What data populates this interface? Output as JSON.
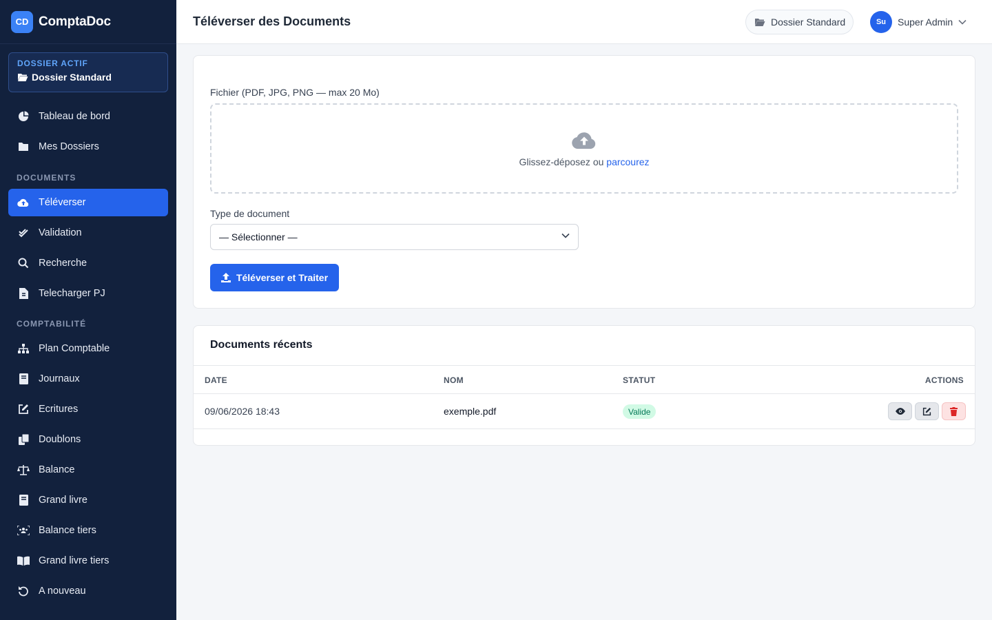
{
  "brand": {
    "badge": "CD",
    "name": "ComptaDoc"
  },
  "active_folder": {
    "label": "DOSSIER ACTIF",
    "value": "Dossier Standard"
  },
  "sidebar": {
    "items_top": [
      {
        "label": "Tableau de bord",
        "icon": "pie-chart-icon"
      },
      {
        "label": "Mes Dossiers",
        "icon": "folder-icon"
      }
    ],
    "section_documents": "DOCUMENTS",
    "items_documents": [
      {
        "label": "Téléverser",
        "icon": "cloud-upload-icon",
        "active": true
      },
      {
        "label": "Validation",
        "icon": "double-check-icon"
      },
      {
        "label": "Recherche",
        "icon": "search-icon"
      },
      {
        "label": "Telecharger PJ",
        "icon": "file-icon"
      }
    ],
    "section_comptabilite": "COMPTABILITÉ",
    "items_comptabilite": [
      {
        "label": "Plan Comptable",
        "icon": "sitemap-icon"
      },
      {
        "label": "Journaux",
        "icon": "book-icon"
      },
      {
        "label": "Ecritures",
        "icon": "edit-icon"
      },
      {
        "label": "Doublons",
        "icon": "copy-icon"
      },
      {
        "label": "Balance",
        "icon": "scale-icon"
      },
      {
        "label": "Grand livre",
        "icon": "book-icon"
      },
      {
        "label": "Balance tiers",
        "icon": "users-icon"
      },
      {
        "label": "Grand livre tiers",
        "icon": "open-book-icon"
      },
      {
        "label": "A nouveau",
        "icon": "undo-icon"
      }
    ]
  },
  "header": {
    "title": "Téléverser des Documents",
    "folder_chip": "Dossier Standard",
    "user": {
      "initials": "Su",
      "name": "Super Admin"
    }
  },
  "upload": {
    "file_label": "Fichier (PDF, JPG, PNG — max 20 Mo)",
    "drop_text": "Glissez-déposez ou",
    "drop_link": "parcourez",
    "type_label": "Type de document",
    "type_value": "— Sélectionner —",
    "submit_label": "Téléverser et Traiter"
  },
  "recent": {
    "title": "Documents récents",
    "columns": [
      "DATE",
      "NOM",
      "STATUT",
      "ACTIONS"
    ],
    "rows": [
      {
        "date": "09/06/2026 18:43",
        "name": "exemple.pdf",
        "status": "Valide"
      }
    ]
  },
  "colors": {
    "primary": "#2563eb",
    "sidebar": "#12213d",
    "success_bg": "#d1fae5",
    "success_text": "#047857",
    "danger": "#dc2626"
  }
}
